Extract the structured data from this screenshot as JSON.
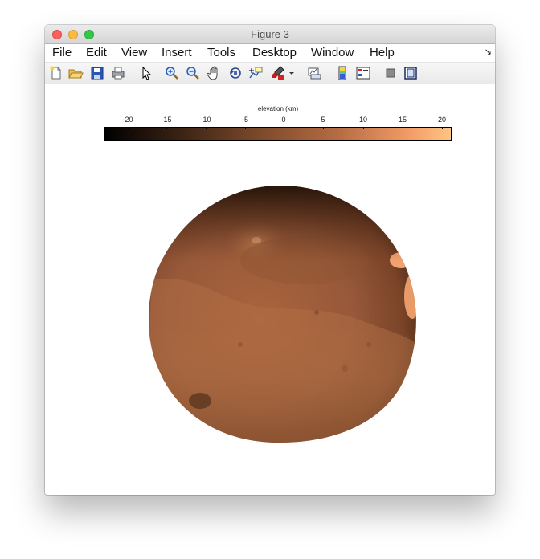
{
  "window": {
    "title": "Figure 3"
  },
  "menubar": {
    "items": [
      "File",
      "Edit",
      "View",
      "Insert",
      "Tools",
      "Desktop",
      "Window",
      "Help"
    ]
  },
  "toolbar": {
    "buttons": [
      "new-figure-icon",
      "open-file-icon",
      "save-icon",
      "print-icon",
      "pointer-icon",
      "zoom-in-icon",
      "zoom-out-icon",
      "pan-hand-icon",
      "rotate-3d-icon",
      "data-cursor-icon",
      "brush-icon",
      "dropdown-arrow-icon",
      "link-plot-icon",
      "insert-colorbar-icon",
      "insert-legend-icon",
      "hide-plot-tools-icon",
      "show-plot-tools-icon"
    ]
  },
  "colorbar": {
    "label": "elevation (km)",
    "ticks": [
      "-20",
      "-15",
      "-10",
      "-5",
      "0",
      "5",
      "10",
      "15",
      "20"
    ],
    "range": [
      -22,
      22
    ],
    "colors": [
      "#000000",
      "#3b2313",
      "#7d4a2b",
      "#b76d44",
      "#f29c66",
      "#ffc484"
    ]
  },
  "figure": {
    "subject": "Mars globe rendered by elevation"
  }
}
